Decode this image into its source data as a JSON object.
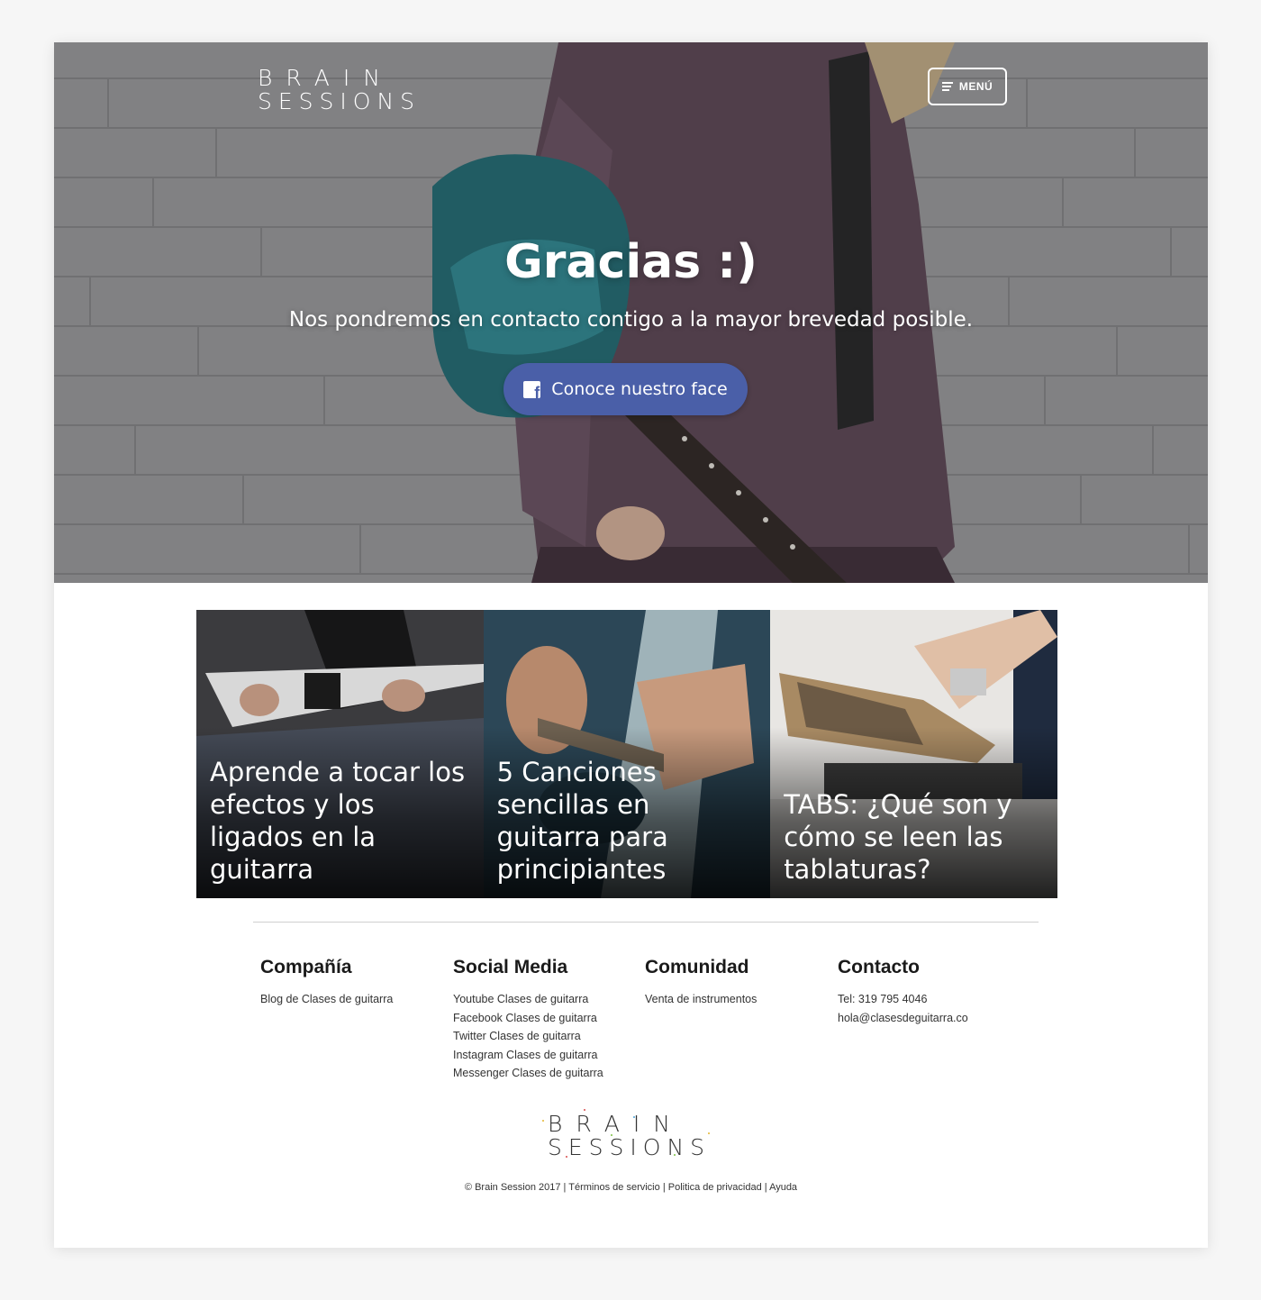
{
  "header": {
    "logo_line1": "BRAIN",
    "logo_line2": "SESSIONS",
    "menu_label": "MENÚ",
    "menu_icon": "hamburger-icon"
  },
  "hero": {
    "title": "Gracias :)",
    "subtitle": "Nos pondremos en contacto contigo a la mayor brevedad posible.",
    "cta_label": "Conoce nuestro face",
    "cta_icon": "facebook-icon",
    "cta_color": "#4a5fa8"
  },
  "articles": [
    {
      "title": "Aprende a tocar los efectos y los ligados en la guitarra"
    },
    {
      "title": "5 Canciones sencillas en guitarra para principiantes"
    },
    {
      "title": "TABS: ¿Qué son y cómo se leen las tablaturas?"
    }
  ],
  "footer": {
    "columns": [
      {
        "heading": "Compañía",
        "links": [
          "Blog de Clases de guitarra"
        ]
      },
      {
        "heading": "Social Media",
        "links": [
          "Youtube Clases de guitarra",
          "Facebook Clases de guitarra",
          "Twitter Clases de guitarra",
          "Instagram Clases de guitarra",
          "Messenger Clases de guitarra"
        ]
      },
      {
        "heading": "Comunidad",
        "links": [
          "Venta de instrumentos"
        ]
      },
      {
        "heading": "Contacto",
        "links": [
          "Tel: 319 795 4046",
          "hola@clasesdeguitarra.co"
        ]
      }
    ],
    "logo_line1": "BRAIN",
    "logo_line2": "SESSIONS",
    "copyright": "© Brain Session 2017",
    "legal_links": [
      "Términos de servicio",
      "Politica de privacidad",
      "Ayuda"
    ]
  }
}
